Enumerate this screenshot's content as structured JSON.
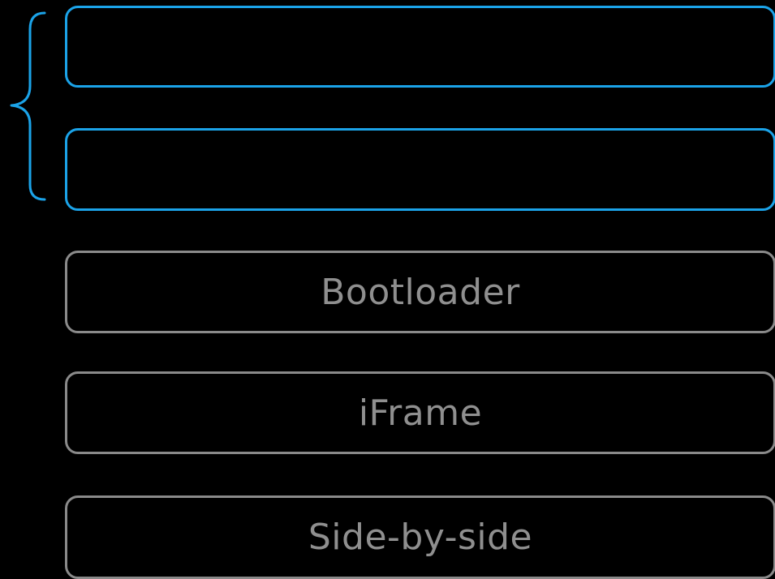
{
  "colors": {
    "background": "#000000",
    "highlight": "#1ba3e8",
    "muted_border": "#8a8a8a",
    "muted_text": "#8f8f8f"
  },
  "boxes": [
    {
      "label": "",
      "state": "highlighted"
    },
    {
      "label": "",
      "state": "highlighted"
    },
    {
      "label": "Bootloader",
      "state": "muted"
    },
    {
      "label": "iFrame",
      "state": "muted"
    },
    {
      "label": "Side-by-side",
      "state": "muted"
    }
  ]
}
